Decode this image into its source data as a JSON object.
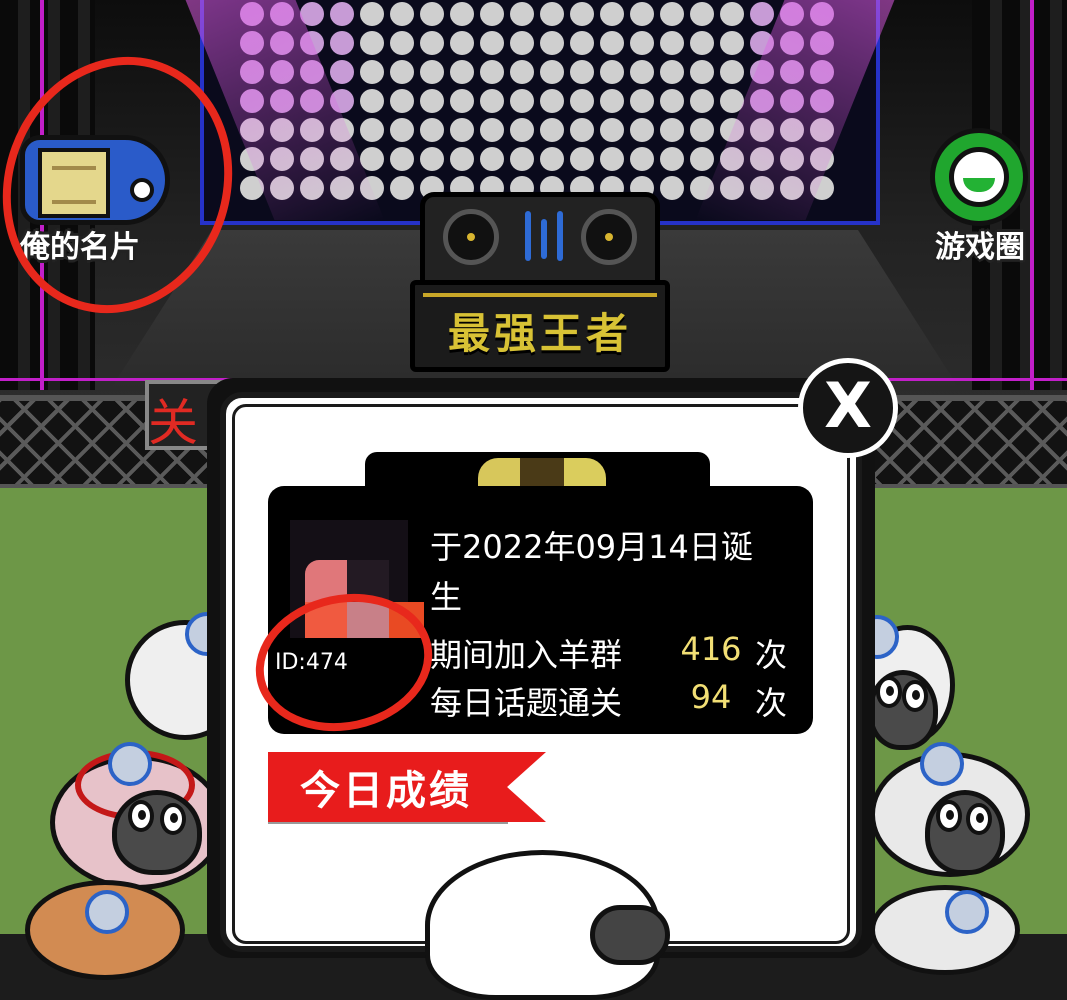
{
  "stage": {
    "title": "最强王者",
    "colors": {
      "neon": "#c21fc9",
      "screen_border": "#2632c9",
      "grass": "#6d9747",
      "title": "#d8c235"
    }
  },
  "side_buttons": {
    "my_card": {
      "label": "俺的名片",
      "icon": "name-tag-icon",
      "color": "#2a5bc9"
    },
    "game_circle": {
      "label": "游戏圈",
      "icon": "chat-bubble-icon",
      "color": "#20a62e"
    }
  },
  "background_text": "关",
  "popup": {
    "close_label": "X",
    "profile": {
      "player_id": "ID:474",
      "birth_line1": "于2022年09月14日诞",
      "birth_line2": "生",
      "stats": [
        {
          "label": "期间加入羊群",
          "value": "416",
          "unit": "次"
        },
        {
          "label": "每日话题通关",
          "value": "94",
          "unit": "次"
        }
      ]
    },
    "today_section_label": "今日成绩",
    "colors": {
      "stat_value": "#f2df75",
      "ribbon": "#e81c1c"
    }
  },
  "annotation": {
    "marker_color": "#e8281c"
  }
}
